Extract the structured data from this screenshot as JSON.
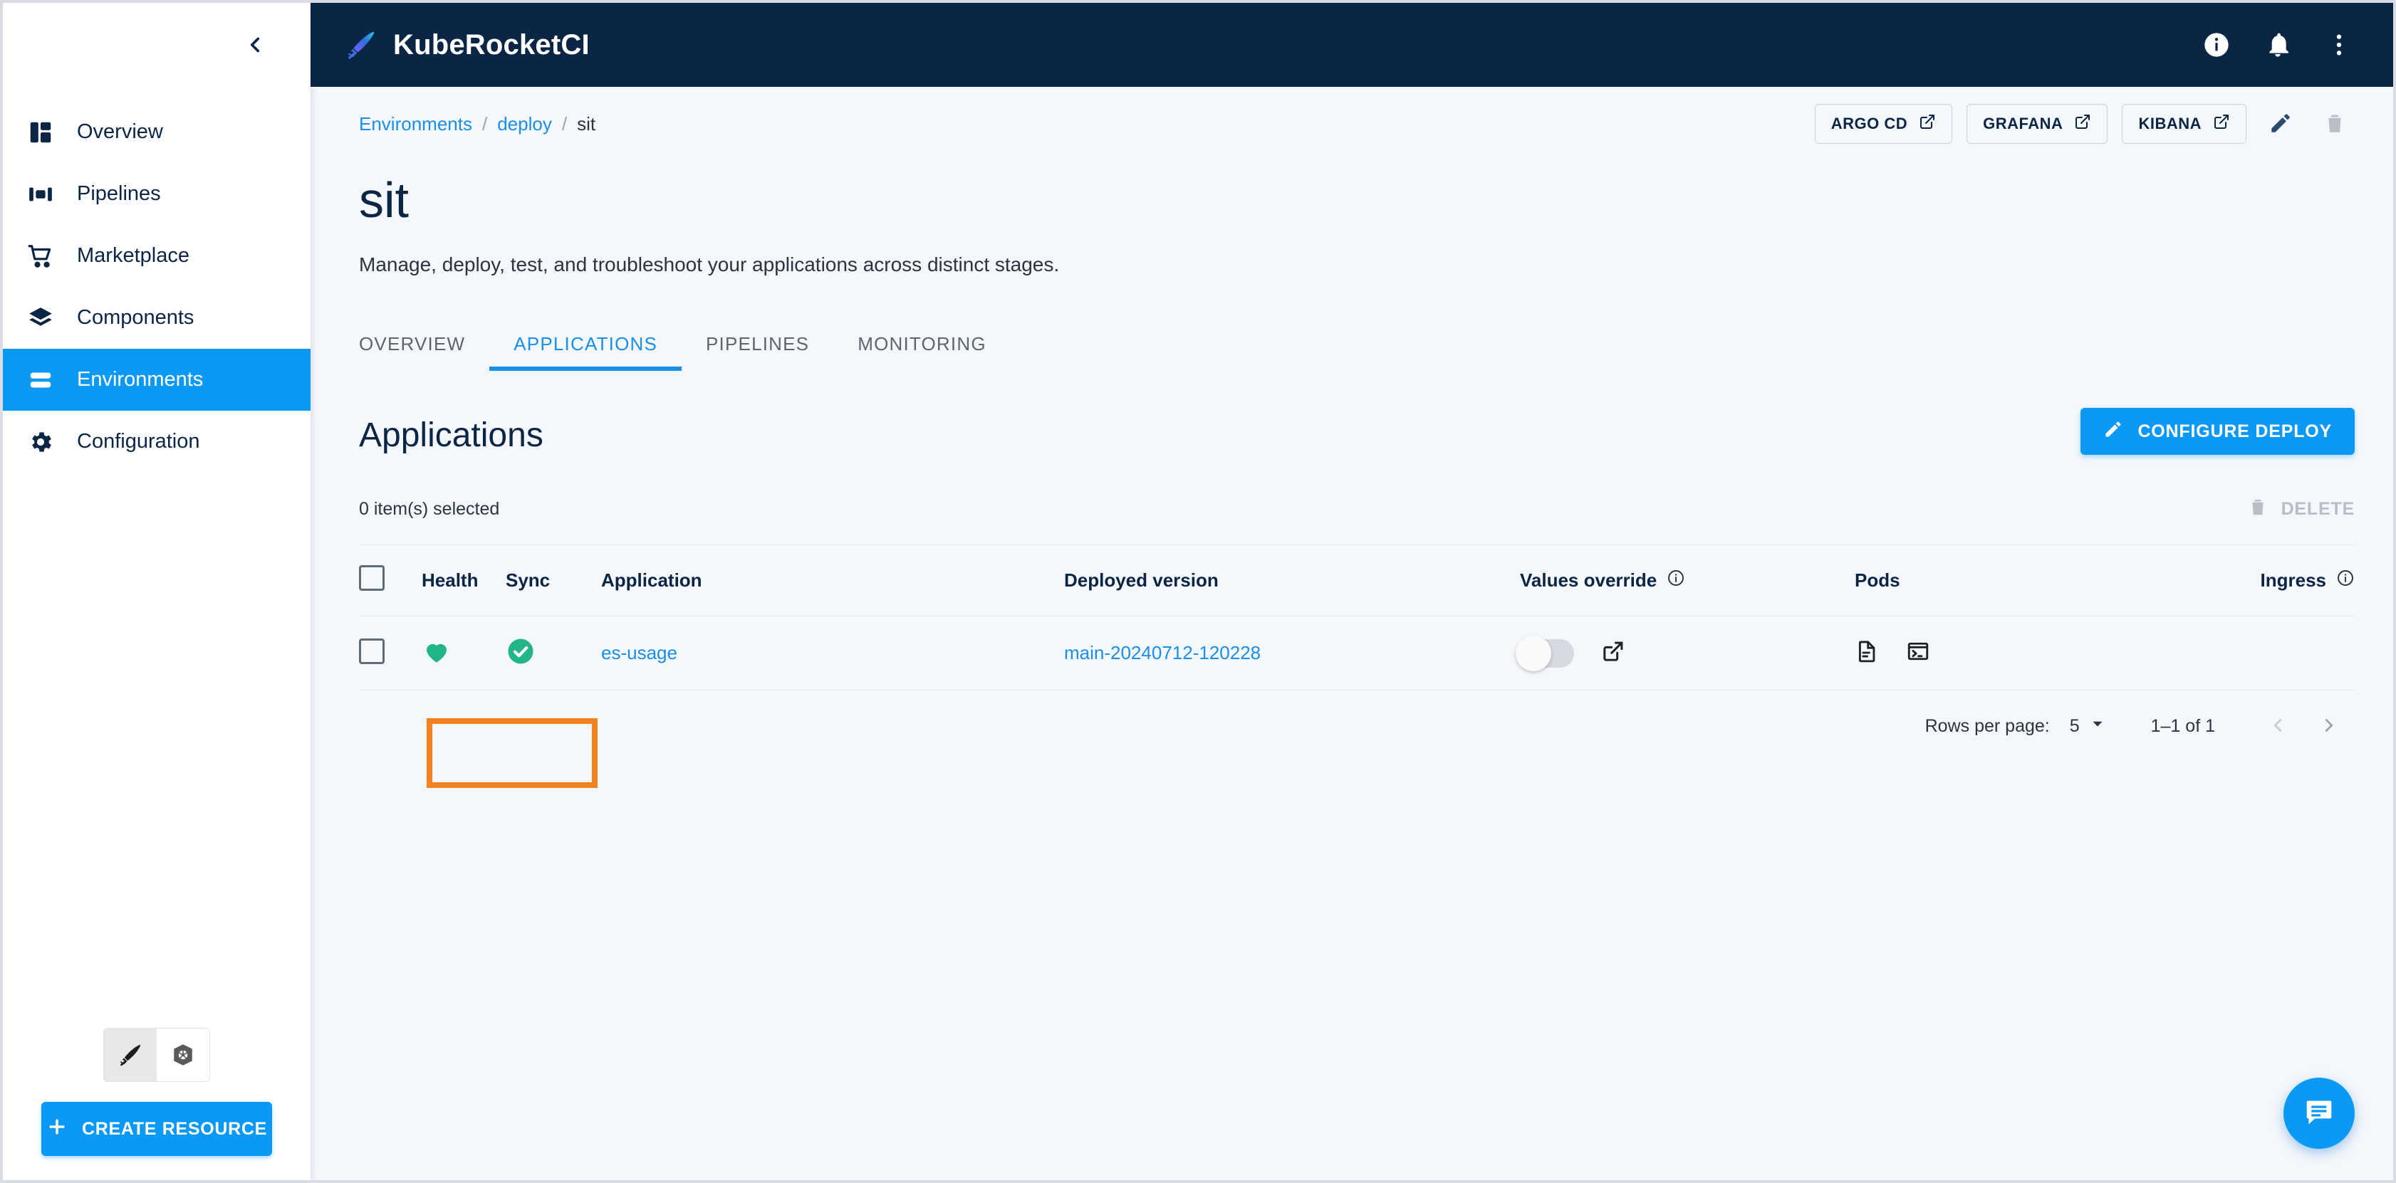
{
  "appbar": {
    "brand": "KubeRocketCI",
    "icons": [
      {
        "name": "info-icon",
        "label": "info"
      },
      {
        "name": "notifications-bell-icon",
        "label": "notifications"
      },
      {
        "name": "overflow-menu-icon",
        "label": "more"
      }
    ]
  },
  "sidebar": {
    "collapse_label": "collapse",
    "items": [
      {
        "label": "Overview",
        "icon": "dashboard-icon",
        "active": false
      },
      {
        "label": "Pipelines",
        "icon": "pipelines-icon",
        "active": false
      },
      {
        "label": "Marketplace",
        "icon": "cart-icon",
        "active": false
      },
      {
        "label": "Components",
        "icon": "layers-icon",
        "active": false
      },
      {
        "label": "Environments",
        "icon": "environments-icon",
        "active": true
      },
      {
        "label": "Configuration",
        "icon": "gear-icon",
        "active": false
      }
    ],
    "segmented": [
      {
        "name": "krci-logo-icon",
        "selected": true
      },
      {
        "name": "kubernetes-icon",
        "selected": false
      }
    ],
    "create_resource_label": "CREATE RESOURCE"
  },
  "breadcrumb": {
    "items": [
      "Environments",
      "deploy",
      "sit"
    ],
    "separator": "/"
  },
  "header_actions": {
    "buttons": [
      {
        "label": "ARGO CD",
        "icon": "external-link-icon"
      },
      {
        "label": "GRAFANA",
        "icon": "external-link-icon"
      },
      {
        "label": "KIBANA",
        "icon": "external-link-icon"
      }
    ],
    "edit_icon": "pencil-icon",
    "delete_icon": "trash-icon"
  },
  "page": {
    "title": "sit",
    "subtitle": "Manage, deploy, test, and troubleshoot your applications across distinct stages."
  },
  "tabs": [
    {
      "label": "OVERVIEW",
      "active": false
    },
    {
      "label": "APPLICATIONS",
      "active": true
    },
    {
      "label": "PIPELINES",
      "active": false
    },
    {
      "label": "MONITORING",
      "active": false
    }
  ],
  "section": {
    "title": "Applications",
    "configure_deploy_label": "CONFIGURE DEPLOY",
    "configure_deploy_icon": "pencil-icon",
    "selected_text": "0 item(s) selected",
    "delete_label": "DELETE",
    "delete_icon": "trash-icon"
  },
  "table": {
    "headers": {
      "health": "Health",
      "sync": "Sync",
      "application": "Application",
      "deployed_version": "Deployed version",
      "values_override": "Values override",
      "pods": "Pods",
      "ingress": "Ingress"
    },
    "info_icon": "info-outline-icon",
    "rows": [
      {
        "checked": false,
        "health": "Healthy",
        "health_icon": "heart-icon",
        "health_color": "#21b588",
        "sync": "Synced",
        "sync_icon": "check-circle-icon",
        "sync_color": "#21b588",
        "application": "es-usage",
        "deployed_version": "main-20240712-120228",
        "values_override_on": false,
        "values_override_link_icon": "external-link-icon",
        "pods_icons": [
          "document-icon",
          "terminal-icon"
        ],
        "ingress": ""
      }
    ]
  },
  "pagination": {
    "rows_per_page_label": "Rows per page:",
    "rows_per_page_value": "5",
    "range_text": "1–1 of 1",
    "prev_icon": "chevron-left-icon",
    "next_icon": "chevron-right-icon"
  },
  "fab": {
    "icon": "chat-bubble-icon"
  },
  "colors": {
    "accent": "#0c99f5",
    "link": "#1a8fe8",
    "navy": "#0b2545",
    "highlight": "#f58220",
    "status_green": "#21b588"
  }
}
